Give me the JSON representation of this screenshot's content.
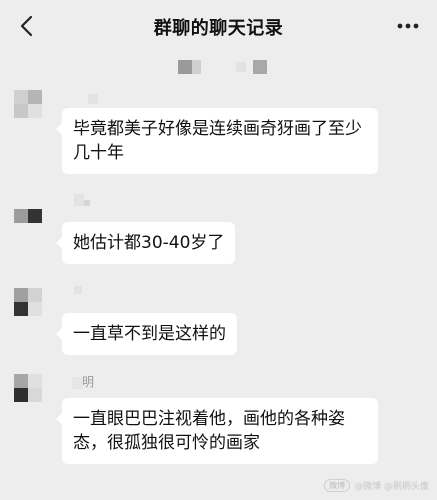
{
  "header": {
    "title": "群聊的聊天记录"
  },
  "messages": [
    {
      "text": "毕竟都美子好像是连续画奇犽画了至少几十年"
    },
    {
      "text": "她估计都30-40岁了"
    },
    {
      "text": "一直草不到是这样的"
    },
    {
      "name_partial": "明",
      "text": "一直眼巴巴注视着他，画他的各种姿态，很孤独很可怜的画家"
    }
  ],
  "watermark": {
    "badge": "微博",
    "text": "@微博 @刷刷头像"
  }
}
